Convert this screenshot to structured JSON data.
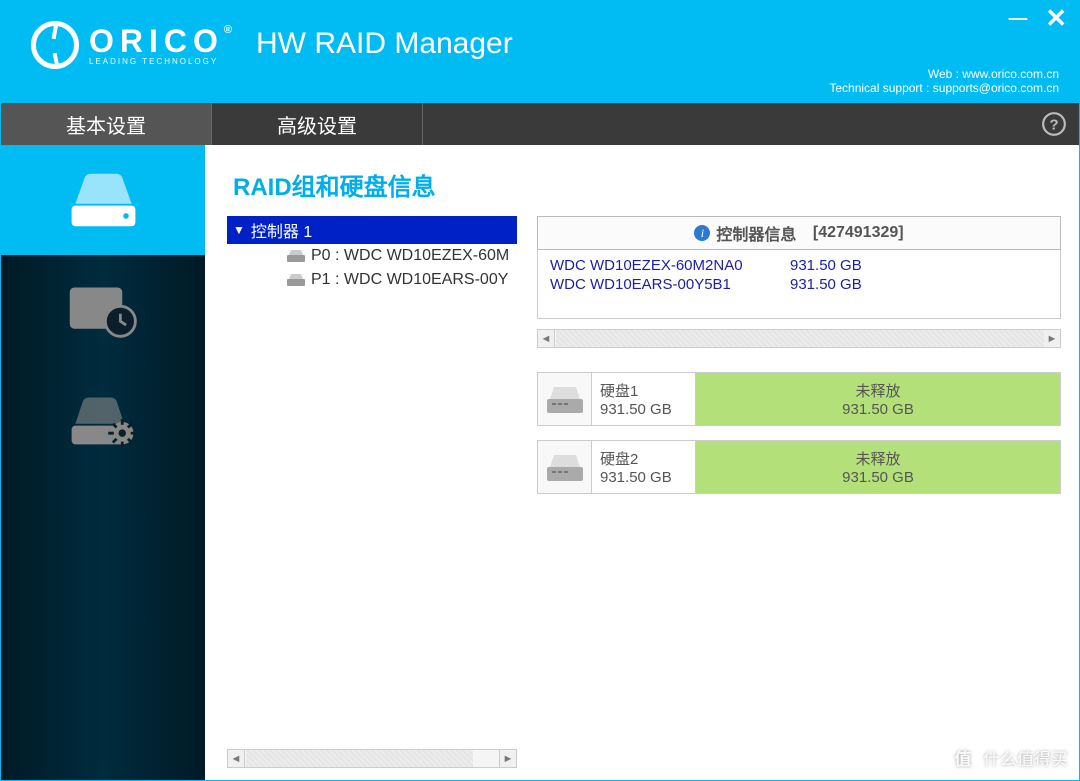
{
  "brand": {
    "name": "ORICO",
    "tagline": "LEADING TECHNOLOGY"
  },
  "app_title": "HW RAID Manager",
  "footer": {
    "web_label": "Web :",
    "web_url": "www.orico.com.cn",
    "support_label": "Technical support :",
    "support_email": "supports@orico.com.cn"
  },
  "tabs": {
    "basic": "基本设置",
    "advanced": "高级设置"
  },
  "page_title": "RAID组和硬盘信息",
  "tree": {
    "controller_label": "控制器 1",
    "items": [
      {
        "label": "P0 : WDC WD10EZEX-60M"
      },
      {
        "label": "P1 : WDC WD10EARS-00Y"
      }
    ]
  },
  "info_header": {
    "label": "控制器信息",
    "id": "[427491329]"
  },
  "drives": [
    {
      "model": "WDC WD10EZEX-60M2NA0",
      "size": "931.50 GB"
    },
    {
      "model": "WDC WD10EARS-00Y5B1",
      "size": "931.50 GB"
    }
  ],
  "disks": [
    {
      "name": "硬盘1",
      "size": "931.50 GB",
      "status": "未释放",
      "status_size": "931.50 GB"
    },
    {
      "name": "硬盘2",
      "size": "931.50 GB",
      "status": "未释放",
      "status_size": "931.50 GB"
    }
  ],
  "watermark": "什么值得买"
}
